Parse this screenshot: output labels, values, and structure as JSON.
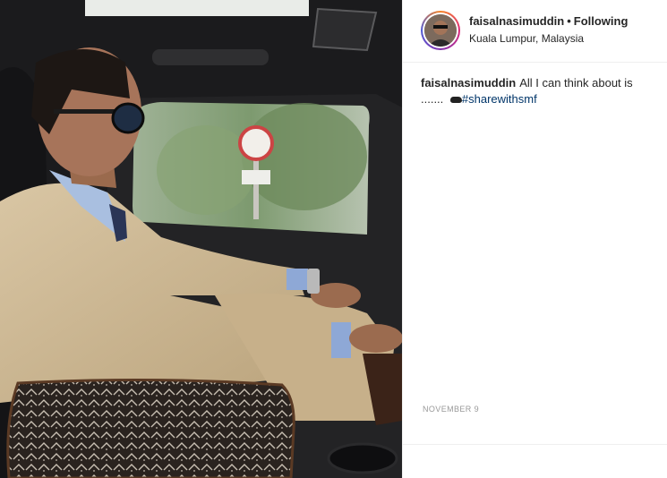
{
  "post": {
    "username": "faisalnasimuddin",
    "separator": "•",
    "follow_status": "Following",
    "location": "Kuala Lumpur, Malaysia",
    "caption_text": "All I can think about is ....... ",
    "hashtag": "#sharewithsmf",
    "date": "NOVEMBER 9"
  },
  "icons": {
    "emoji": "cloud-icon"
  }
}
